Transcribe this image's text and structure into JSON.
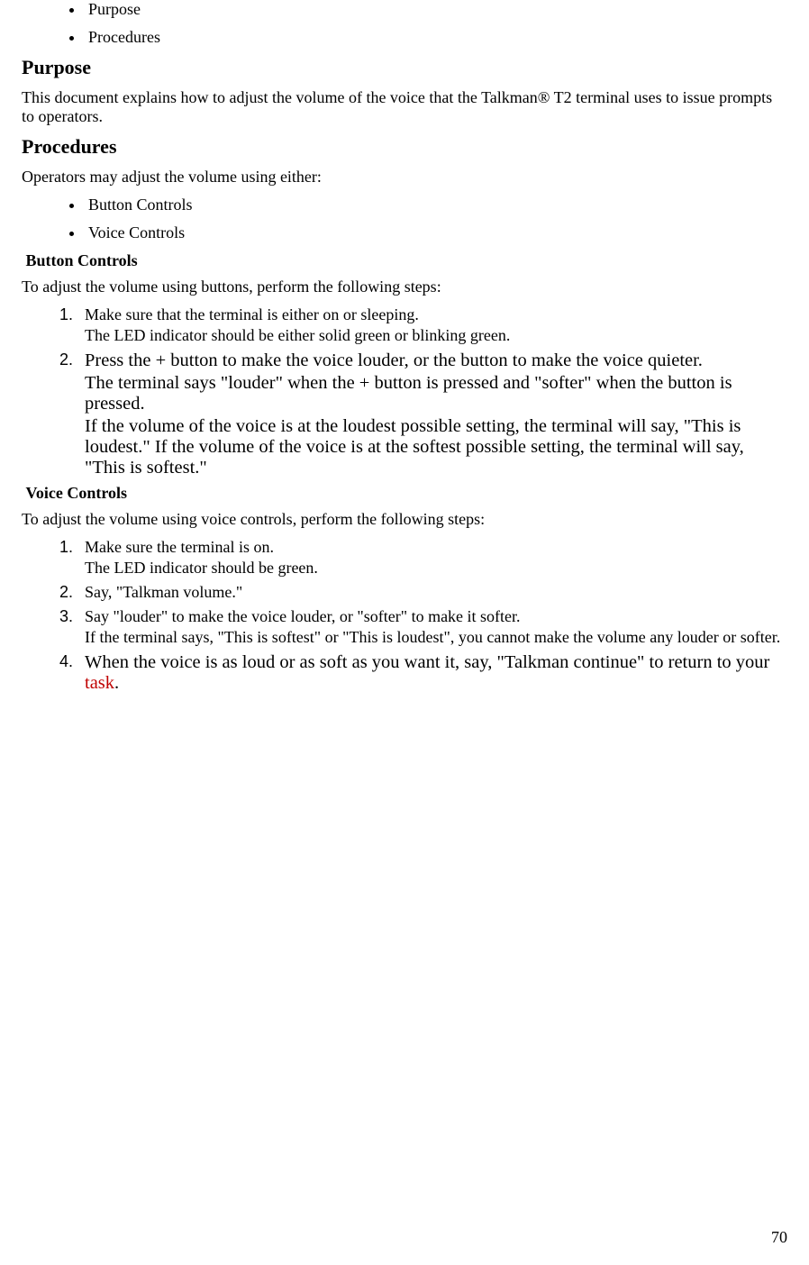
{
  "nav": {
    "item1": "Purpose",
    "item2": "Procedures"
  },
  "purpose": {
    "heading": "Purpose",
    "text": "This document explains how to adjust the volume of the voice that the Talkman® T2 terminal uses to issue prompts to operators."
  },
  "procedures": {
    "heading": "Procedures",
    "intro": "Operators may adjust the volume using either:",
    "option1": "Button Controls",
    "option2": "Voice Controls"
  },
  "button_controls": {
    "heading": "Button Controls",
    "intro": "To adjust the volume using buttons, perform the following steps:",
    "step1_num": "1.",
    "step1_line1": "Make sure that the terminal is either on or sleeping.",
    "step1_line2": " The LED indicator should be either solid green or blinking green.",
    "step2_num": "2.",
    "step2_line1": "Press the + button to make the voice louder, or the  button to make the voice quieter.",
    "step2_line2": " The terminal says \"louder\" when the + button is pressed and \"softer\" when the  button is pressed.",
    "step2_line3": " If the volume of the voice is at the loudest possible setting, the terminal will say, \"This is loudest.\" If the volume of the voice is at the softest possible setting, the terminal will say, \"This is softest.\""
  },
  "voice_controls": {
    "heading": "Voice Controls",
    "intro": "To adjust the volume using voice controls, perform the following steps:",
    "step1_num": "1.",
    "step1_line1": "Make sure the terminal is on.",
    "step1_line2": " The LED indicator should be green.",
    "step2_num": "2.",
    "step2_line1": "Say, \"Talkman volume.\"",
    "step3_num": "3.",
    "step3_line1": "Say \"louder\" to make the voice louder, or \"softer\" to make it softer.",
    "step3_line2": " If the terminal says, \"This is softest\" or \"This is loudest\", you cannot make the volume any louder or softer.",
    "step4_num": "4.",
    "step4_pre": "When the voice is as loud or as soft as you want it, say, \"Talkman continue\" to return to your ",
    "step4_link": "task",
    "step4_post": "."
  },
  "page_number": "70"
}
